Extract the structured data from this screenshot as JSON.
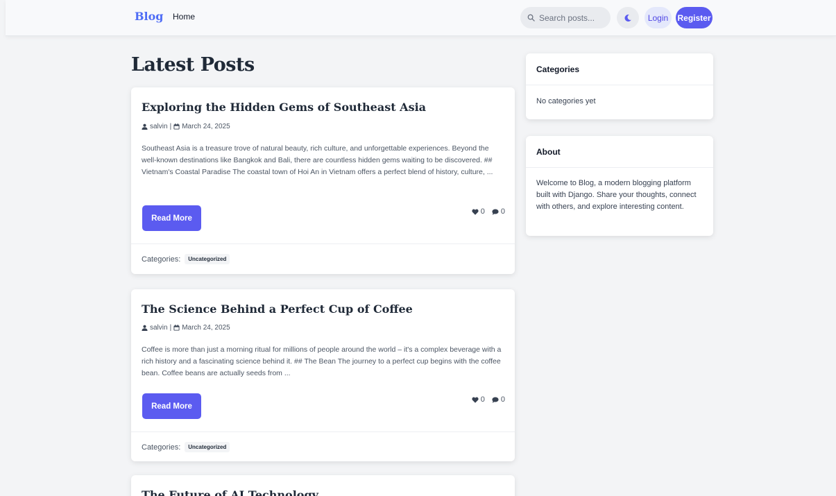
{
  "nav": {
    "brand": "Blog",
    "home": "Home",
    "search_placeholder": "Search posts...",
    "theme_icon": "moon-icon",
    "login": "Login",
    "register": "Register",
    "colors": {
      "brand": "#4f6df5",
      "primary": "#5b5bf0"
    }
  },
  "main": {
    "title": "Latest Posts",
    "posts": [
      {
        "title": "Exploring the Hidden Gems of Southeast Asia",
        "author": "salvin",
        "separator": "|",
        "date": "March 24, 2025",
        "excerpt": "Southeast Asia is a treasure trove of natural beauty, rich culture, and unforgettable experiences. Beyond the well-known destinations like Bangkok and Bali, there are countless hidden gems waiting to be discovered. ## Vietnam's Coastal Paradise The coastal town of Hoi An in Vietnam offers a perfect blend of history, culture, ...",
        "read_more": "Read More",
        "likes": "0",
        "comments": "0",
        "categories_label": "Categories:",
        "category": "Uncategorized"
      },
      {
        "title": "The Science Behind a Perfect Cup of Coffee",
        "author": "salvin",
        "separator": "|",
        "date": "March 24, 2025",
        "excerpt": "Coffee is more than just a morning ritual for millions of people around the world – it's a complex beverage with a rich history and a fascinating science behind it. ## The Bean The journey to a perfect cup begins with the coffee bean. Coffee beans are actually seeds from ...",
        "read_more": "Read More",
        "likes": "0",
        "comments": "0",
        "categories_label": "Categories:",
        "category": "Uncategorized"
      },
      {
        "title": "The Future of AI Technology"
      }
    ]
  },
  "sidebar": {
    "categories": {
      "heading": "Categories",
      "empty": "No categories yet"
    },
    "about": {
      "heading": "About",
      "text": "Welcome to Blog, a modern blogging platform built with Django. Share your thoughts, connect with others, and explore interesting content."
    }
  }
}
